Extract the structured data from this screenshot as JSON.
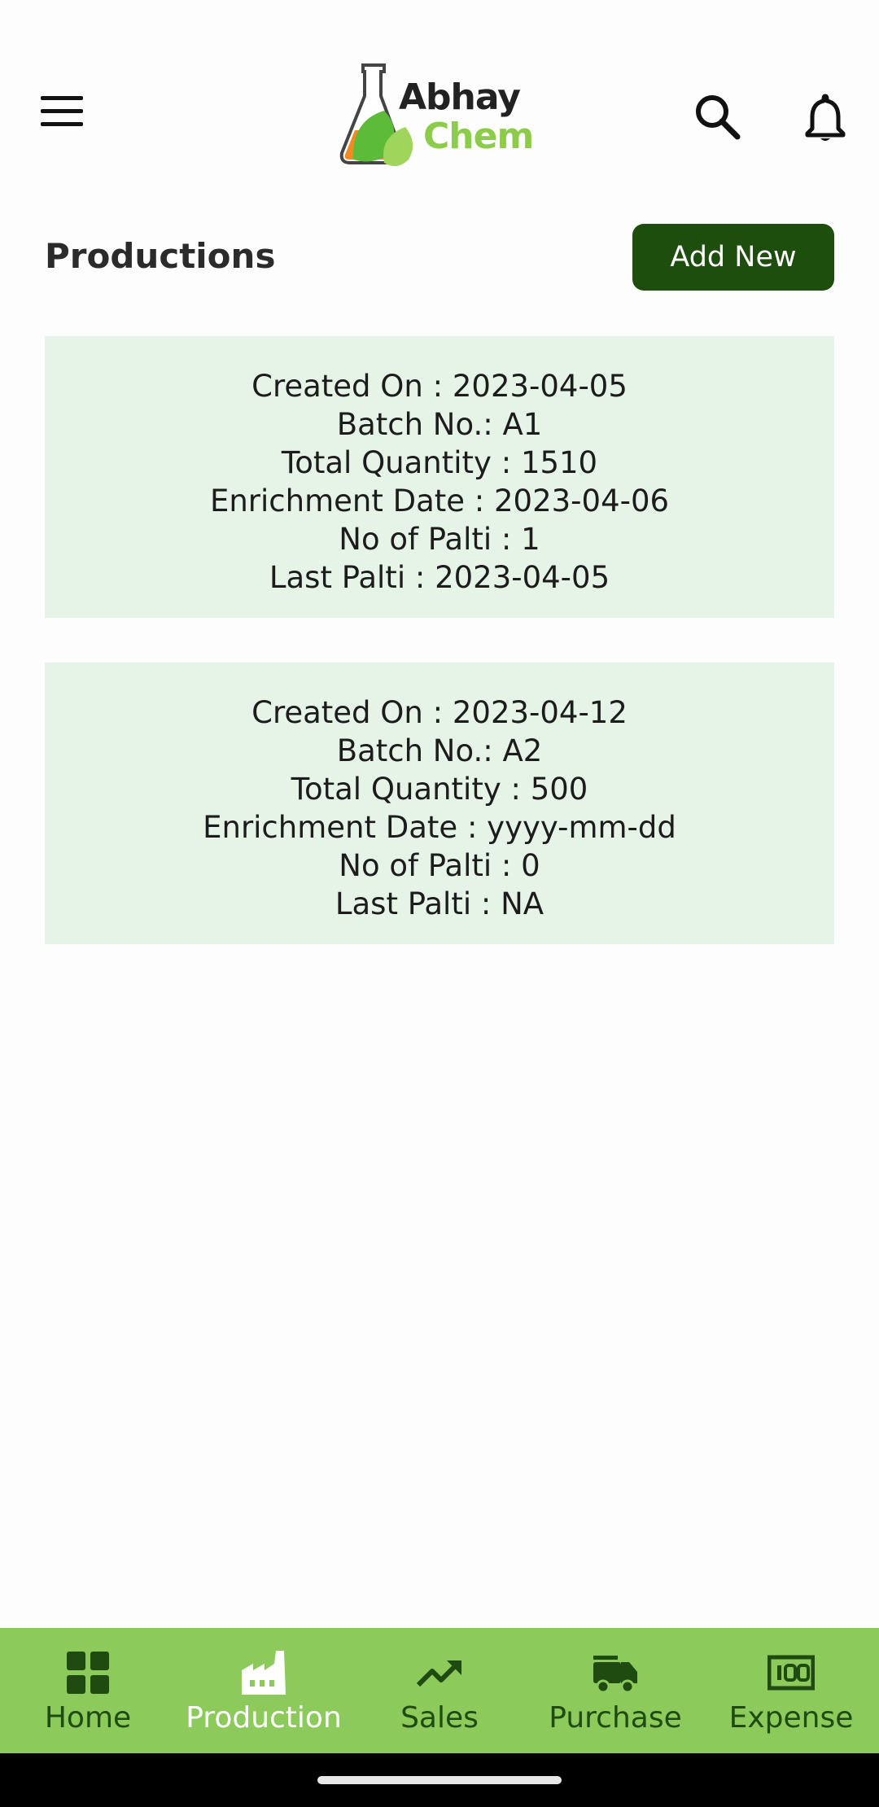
{
  "header": {
    "logo_text_line1": "Abhay",
    "logo_text_line2": "Chem"
  },
  "page": {
    "title": "Productions",
    "add_button_label": "Add New"
  },
  "productions": [
    {
      "created_on": "Created On : 2023-04-05",
      "batch_no": "Batch No.: A1",
      "total_quantity": "Total Quantity : 1510",
      "enrichment_date": "Enrichment Date : 2023-04-06",
      "no_of_palti": "No of Palti : 1",
      "last_palti": "Last Palti : 2023-04-05"
    },
    {
      "created_on": "Created On : 2023-04-12",
      "batch_no": "Batch No.: A2",
      "total_quantity": "Total Quantity : 500",
      "enrichment_date": "Enrichment Date : yyyy-mm-dd",
      "no_of_palti": "No of Palti : 0",
      "last_palti": "Last Palti : NA"
    }
  ],
  "bottom_nav": {
    "items": [
      {
        "label": "Home",
        "icon": "dashboard-icon"
      },
      {
        "label": "Production",
        "icon": "factory-icon",
        "active": true
      },
      {
        "label": "Sales",
        "icon": "trending-up-icon"
      },
      {
        "label": "Purchase",
        "icon": "truck-icon"
      },
      {
        "label": "Expense",
        "icon": "money-icon"
      }
    ]
  },
  "colors": {
    "accent": "#1e4e0e",
    "card_bg": "#e5f4e7",
    "nav_bg": "#8cca5c",
    "logo_green": "#8ccc4a"
  }
}
